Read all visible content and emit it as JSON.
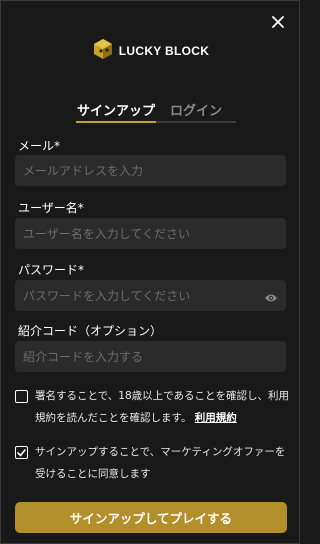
{
  "brand": {
    "name": "LUCKY BLOCK",
    "accent": "#c9a227",
    "button_color": "#b38f2b"
  },
  "tabs": [
    {
      "label": "サインアップ",
      "active": true
    },
    {
      "label": "ログイン",
      "active": false
    }
  ],
  "form": {
    "email": {
      "label": "メール",
      "required_mark": "*",
      "placeholder": "メールアドレスを入力",
      "value": ""
    },
    "username": {
      "label": "ユーザー名",
      "required_mark": "*",
      "placeholder": "ユーザー名を入力してください",
      "value": ""
    },
    "password": {
      "label": "パスワード",
      "required_mark": "*",
      "placeholder": "パスワードを入力してください",
      "value": ""
    },
    "referral": {
      "label": "紹介コード（オプション）",
      "placeholder": "紹介コードを入力する",
      "value": ""
    }
  },
  "consents": {
    "terms": {
      "checked": false,
      "text": "署名することで、18歳以上であることを確認し、利用規約を読んだことを確認します。",
      "link": "利用規約"
    },
    "marketing": {
      "checked": true,
      "text": "サインアップすることで、マーケティングオファーを受けることに同意します"
    }
  },
  "submit_label": "サインアップしてプレイする",
  "icons": {
    "close": "close-icon",
    "logo": "lucky-block-logo-icon",
    "eye": "eye-icon",
    "check": "check-icon"
  }
}
